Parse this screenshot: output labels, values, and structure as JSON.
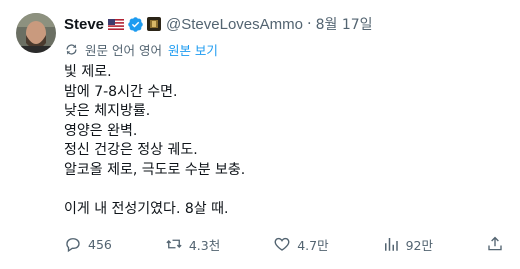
{
  "author": {
    "name": "Steve",
    "handle": "@SteveLovesAmmo",
    "date": "8월 17일",
    "flag_icon": "us-flag-icon",
    "verified_icon": "verified-badge-icon",
    "affiliate_icon": "affiliate-badge-icon"
  },
  "translation": {
    "notice": "원문 언어 영어",
    "show_original": "원본 보기"
  },
  "post": {
    "lines": [
      "빛 제로.",
      "밤에 7-8시간 수면.",
      "낮은 체지방률.",
      "영양은 완벽.",
      "정신 건강은 정상 궤도.",
      "알코올 제로, 극도로 수분 보충.",
      "",
      "이게 내 전성기였다. 8살 때."
    ]
  },
  "actions": {
    "replies": "456",
    "reposts": "4.3천",
    "likes": "4.7만",
    "views": "92만"
  },
  "colors": {
    "text": "#0f1419",
    "muted": "#536471",
    "link": "#1d9bf0",
    "verified": "#1d9bf0"
  }
}
